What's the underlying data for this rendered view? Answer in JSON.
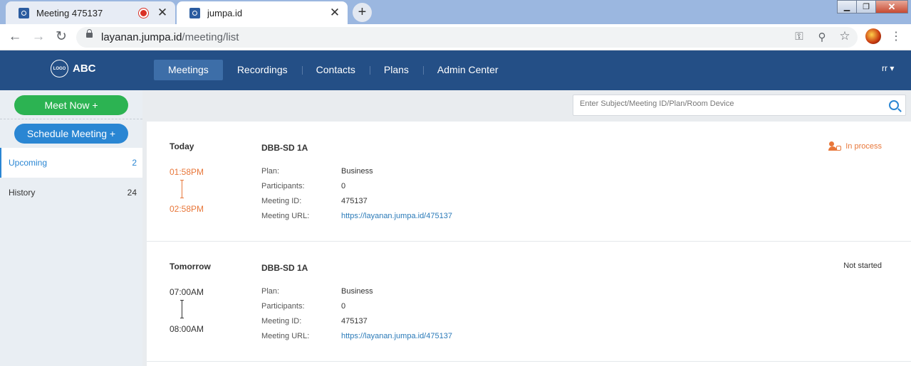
{
  "browser": {
    "tabs": [
      {
        "title": "Meeting 475137",
        "close": "✕"
      },
      {
        "title": "jumpa.id",
        "close": "✕"
      }
    ],
    "new_tab": "+",
    "url_host": "layanan.jumpa.id",
    "url_path": "/meeting/list",
    "nav": {
      "back": "←",
      "forward": "→",
      "reload": "↻"
    },
    "omnibox_icons": {
      "key": "⚿",
      "zoom": "⚲",
      "star": "☆"
    },
    "menu": "⋮"
  },
  "header": {
    "logo_text": "LOGO",
    "brand_name": "ABC",
    "nav_items": [
      "Meetings",
      "Recordings",
      "Contacts",
      "Plans",
      "Admin Center"
    ],
    "user": "rr ▾"
  },
  "sidebar": {
    "meet_now": "Meet Now +",
    "schedule_meeting": "Schedule Meeting +",
    "filters": [
      {
        "label": "Upcoming",
        "count": "2"
      },
      {
        "label": "History",
        "count": "24"
      }
    ]
  },
  "search": {
    "placeholder": "Enter Subject/Meeting ID/Plan/Room Device"
  },
  "labels": {
    "plan": "Plan:",
    "participants": "Participants:",
    "meeting_id": "Meeting ID:",
    "meeting_url": "Meeting URL:"
  },
  "meetings": [
    {
      "day": "Today",
      "start": "01:58PM",
      "end": "02:58PM",
      "subject": "DBB-SD 1A",
      "plan": "Business",
      "participants": "0",
      "meeting_id": "475137",
      "meeting_url": "https://layanan.jumpa.id/475137",
      "status": "In process",
      "status_color": "#e8773a"
    },
    {
      "day": "Tomorrow",
      "start": "07:00AM",
      "end": "08:00AM",
      "subject": "DBB-SD 1A",
      "plan": "Business",
      "participants": "0",
      "meeting_id": "475137",
      "meeting_url": "https://layanan.jumpa.id/475137",
      "status": "Not started",
      "status_color": "#333333"
    }
  ],
  "colors": {
    "header_bg": "#244f86",
    "meet_now_green": "#2cb352",
    "schedule_blue": "#2a86d3",
    "accent_orange": "#e8773a"
  }
}
